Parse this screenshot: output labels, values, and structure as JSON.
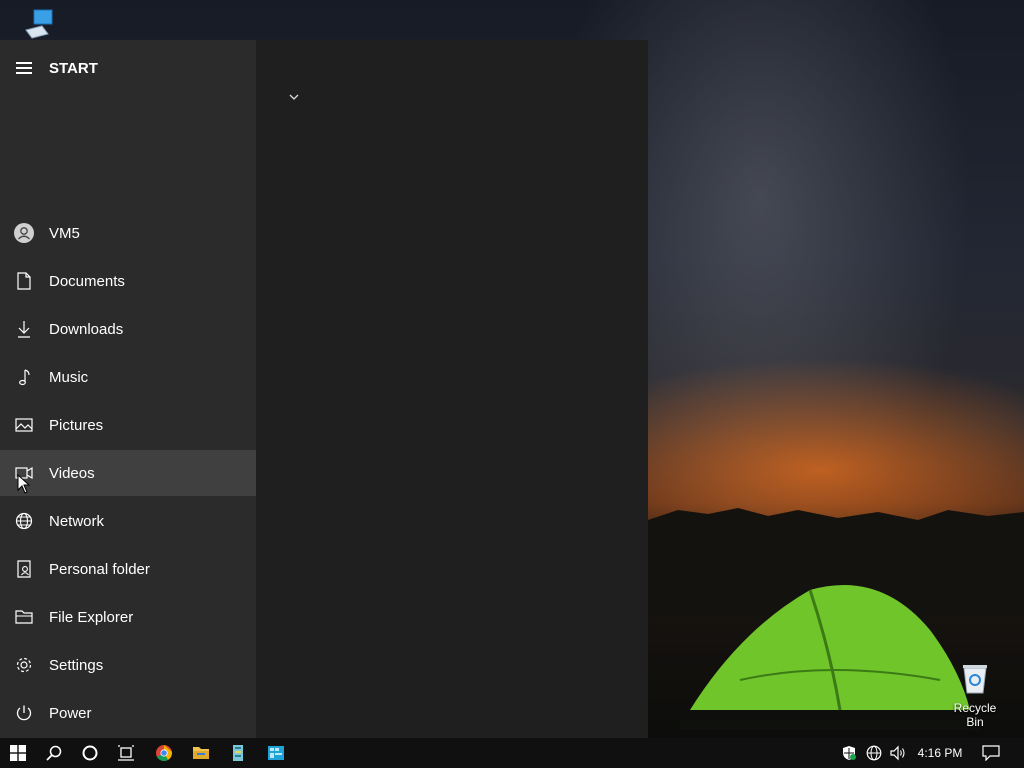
{
  "start_menu": {
    "title": "START",
    "items": [
      {
        "label": "VM5",
        "icon": "user-avatar-icon"
      },
      {
        "label": "Documents",
        "icon": "document-icon"
      },
      {
        "label": "Downloads",
        "icon": "download-icon"
      },
      {
        "label": "Music",
        "icon": "music-note-icon"
      },
      {
        "label": "Pictures",
        "icon": "picture-icon"
      },
      {
        "label": "Videos",
        "icon": "video-camera-icon"
      },
      {
        "label": "Network",
        "icon": "globe-icon"
      },
      {
        "label": "Personal folder",
        "icon": "personal-folder-icon"
      },
      {
        "label": "File Explorer",
        "icon": "file-explorer-icon"
      },
      {
        "label": "Settings",
        "icon": "gear-icon"
      },
      {
        "label": "Power",
        "icon": "power-icon"
      }
    ],
    "hovered_item": "Videos"
  },
  "desktop": {
    "recycle_bin_label": "Recycle Bin"
  },
  "taskbar": {
    "pinned": [
      "windows-start-icon",
      "search-icon",
      "cortana-icon",
      "task-view-icon",
      "chrome-icon",
      "file-explorer-icon",
      "app-icon",
      "app-icon"
    ],
    "tray": {
      "time": "4:16 PM"
    }
  },
  "colors": {
    "start_left_bg": "#2b2b2b",
    "start_right_bg": "#1f1f1f",
    "hover_bg": "#404040",
    "taskbar_bg": "#101010"
  }
}
